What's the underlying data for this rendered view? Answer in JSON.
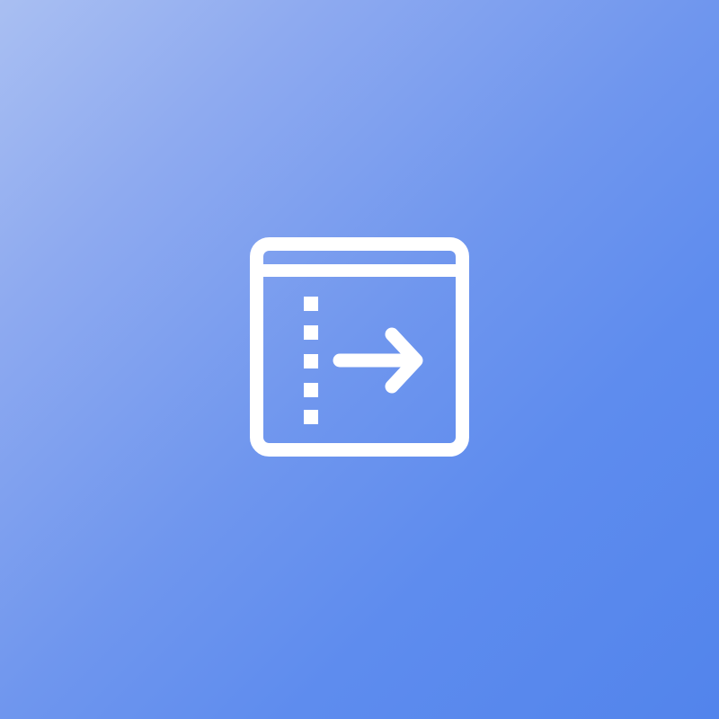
{
  "background": {
    "gradient_from": "#a9bff2",
    "gradient_to": "#5284ec"
  },
  "icon": {
    "name": "indent-right-icon",
    "color": "#ffffff"
  }
}
